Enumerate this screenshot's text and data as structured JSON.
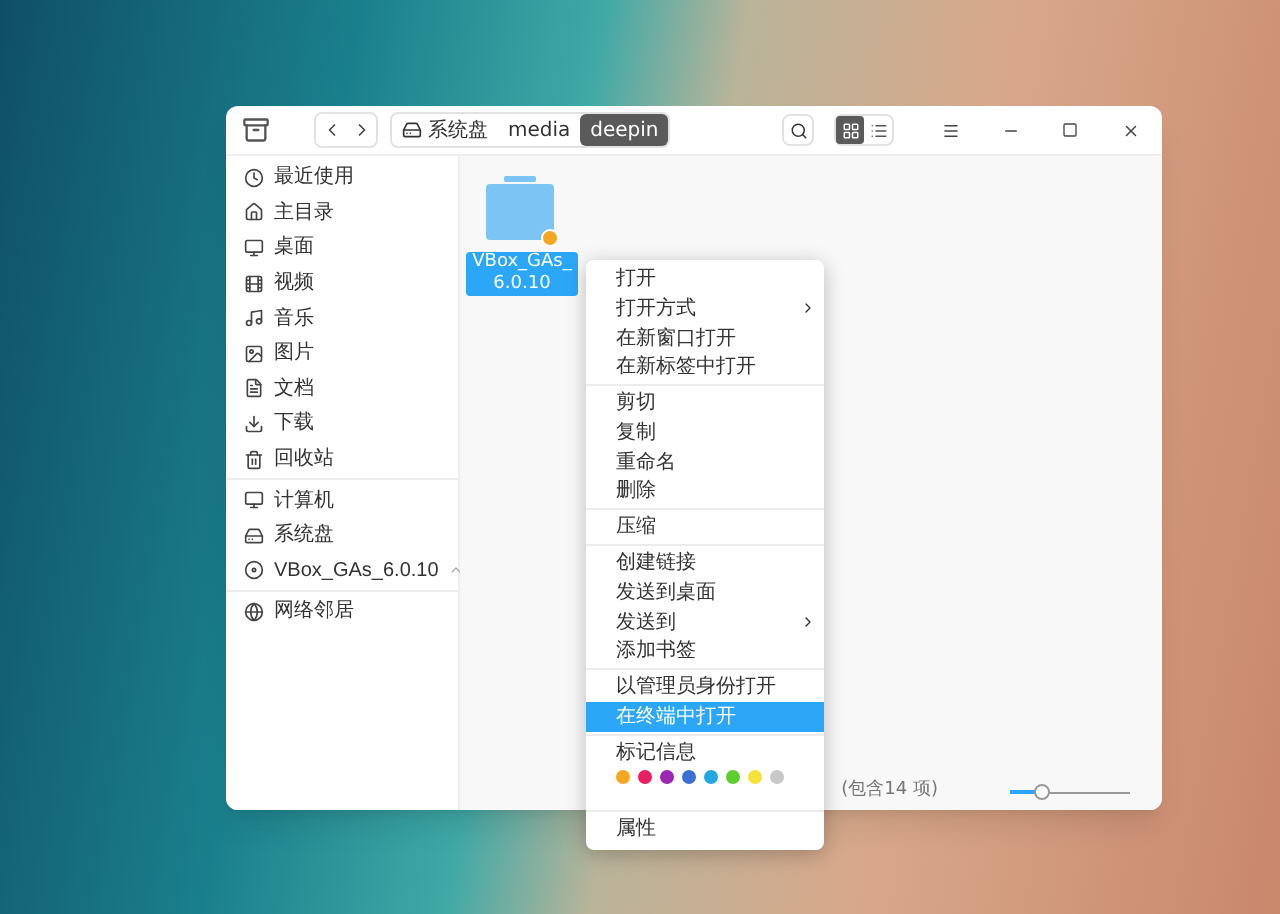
{
  "toolbar": {
    "breadcrumb": [
      {
        "label": "系统盘",
        "selected": false
      },
      {
        "label": "media",
        "selected": false
      },
      {
        "label": "deepin",
        "selected": true
      }
    ],
    "view_modes": [
      {
        "selected": true
      },
      {
        "selected": false
      }
    ]
  },
  "sidebar": {
    "groups": [
      [
        {
          "label": "最近使用"
        },
        {
          "label": "主目录"
        },
        {
          "label": "桌面"
        },
        {
          "label": "视频"
        },
        {
          "label": "音乐"
        },
        {
          "label": "图片"
        },
        {
          "label": "文档"
        },
        {
          "label": "下载"
        },
        {
          "label": "回收站"
        }
      ],
      [
        {
          "label": "计算机"
        },
        {
          "label": "系统盘"
        },
        {
          "label": "VBox_GAs_6.0.10",
          "ejectable": true
        }
      ],
      [
        {
          "label": "网络邻居"
        }
      ]
    ]
  },
  "files": [
    {
      "name": "VBox_GAs_6.0.10",
      "selected": true
    }
  ],
  "status_bar": {
    "text": "(包含14 项)",
    "zoom": {
      "level": 0.27
    }
  },
  "context_menu": {
    "sections": [
      {
        "kind": "items",
        "items": [
          {
            "label": "打开",
            "submenu": false,
            "selected": false
          },
          {
            "label": "打开方式",
            "submenu": true,
            "selected": false
          },
          {
            "label": "在新窗口打开",
            "submenu": false,
            "selected": false
          },
          {
            "label": "在新标签中打开",
            "submenu": false,
            "selected": false
          }
        ]
      },
      {
        "kind": "items",
        "items": [
          {
            "label": "剪切",
            "submenu": false,
            "selected": false
          },
          {
            "label": "复制",
            "submenu": false,
            "selected": false
          },
          {
            "label": "重命名",
            "submenu": false,
            "selected": false
          },
          {
            "label": "删除",
            "submenu": false,
            "selected": false
          }
        ]
      },
      {
        "kind": "items",
        "items": [
          {
            "label": "压缩",
            "submenu": false,
            "selected": false
          }
        ]
      },
      {
        "kind": "items",
        "items": [
          {
            "label": "创建链接",
            "submenu": false,
            "selected": false
          },
          {
            "label": "发送到桌面",
            "submenu": false,
            "selected": false
          },
          {
            "label": "发送到",
            "submenu": true,
            "selected": false
          },
          {
            "label": "添加书签",
            "submenu": false,
            "selected": false
          }
        ]
      },
      {
        "kind": "items",
        "items": [
          {
            "label": "以管理员身份打开",
            "submenu": false,
            "selected": false
          },
          {
            "label": "在终端中打开",
            "submenu": false,
            "selected": true
          }
        ]
      },
      {
        "kind": "tags",
        "label": "标记信息",
        "colors": [
          {
            "color": "#f5a623"
          },
          {
            "color": "#e91e63"
          },
          {
            "color": "#9c27b0"
          },
          {
            "color": "#3b6fd6"
          },
          {
            "color": "#22a7e0"
          },
          {
            "color": "#5ccf2e"
          },
          {
            "color": "#f5e33b"
          },
          {
            "color": "#c8c8c8"
          }
        ]
      },
      {
        "kind": "items",
        "items": [
          {
            "label": "属性",
            "submenu": false,
            "selected": false
          }
        ]
      }
    ]
  }
}
